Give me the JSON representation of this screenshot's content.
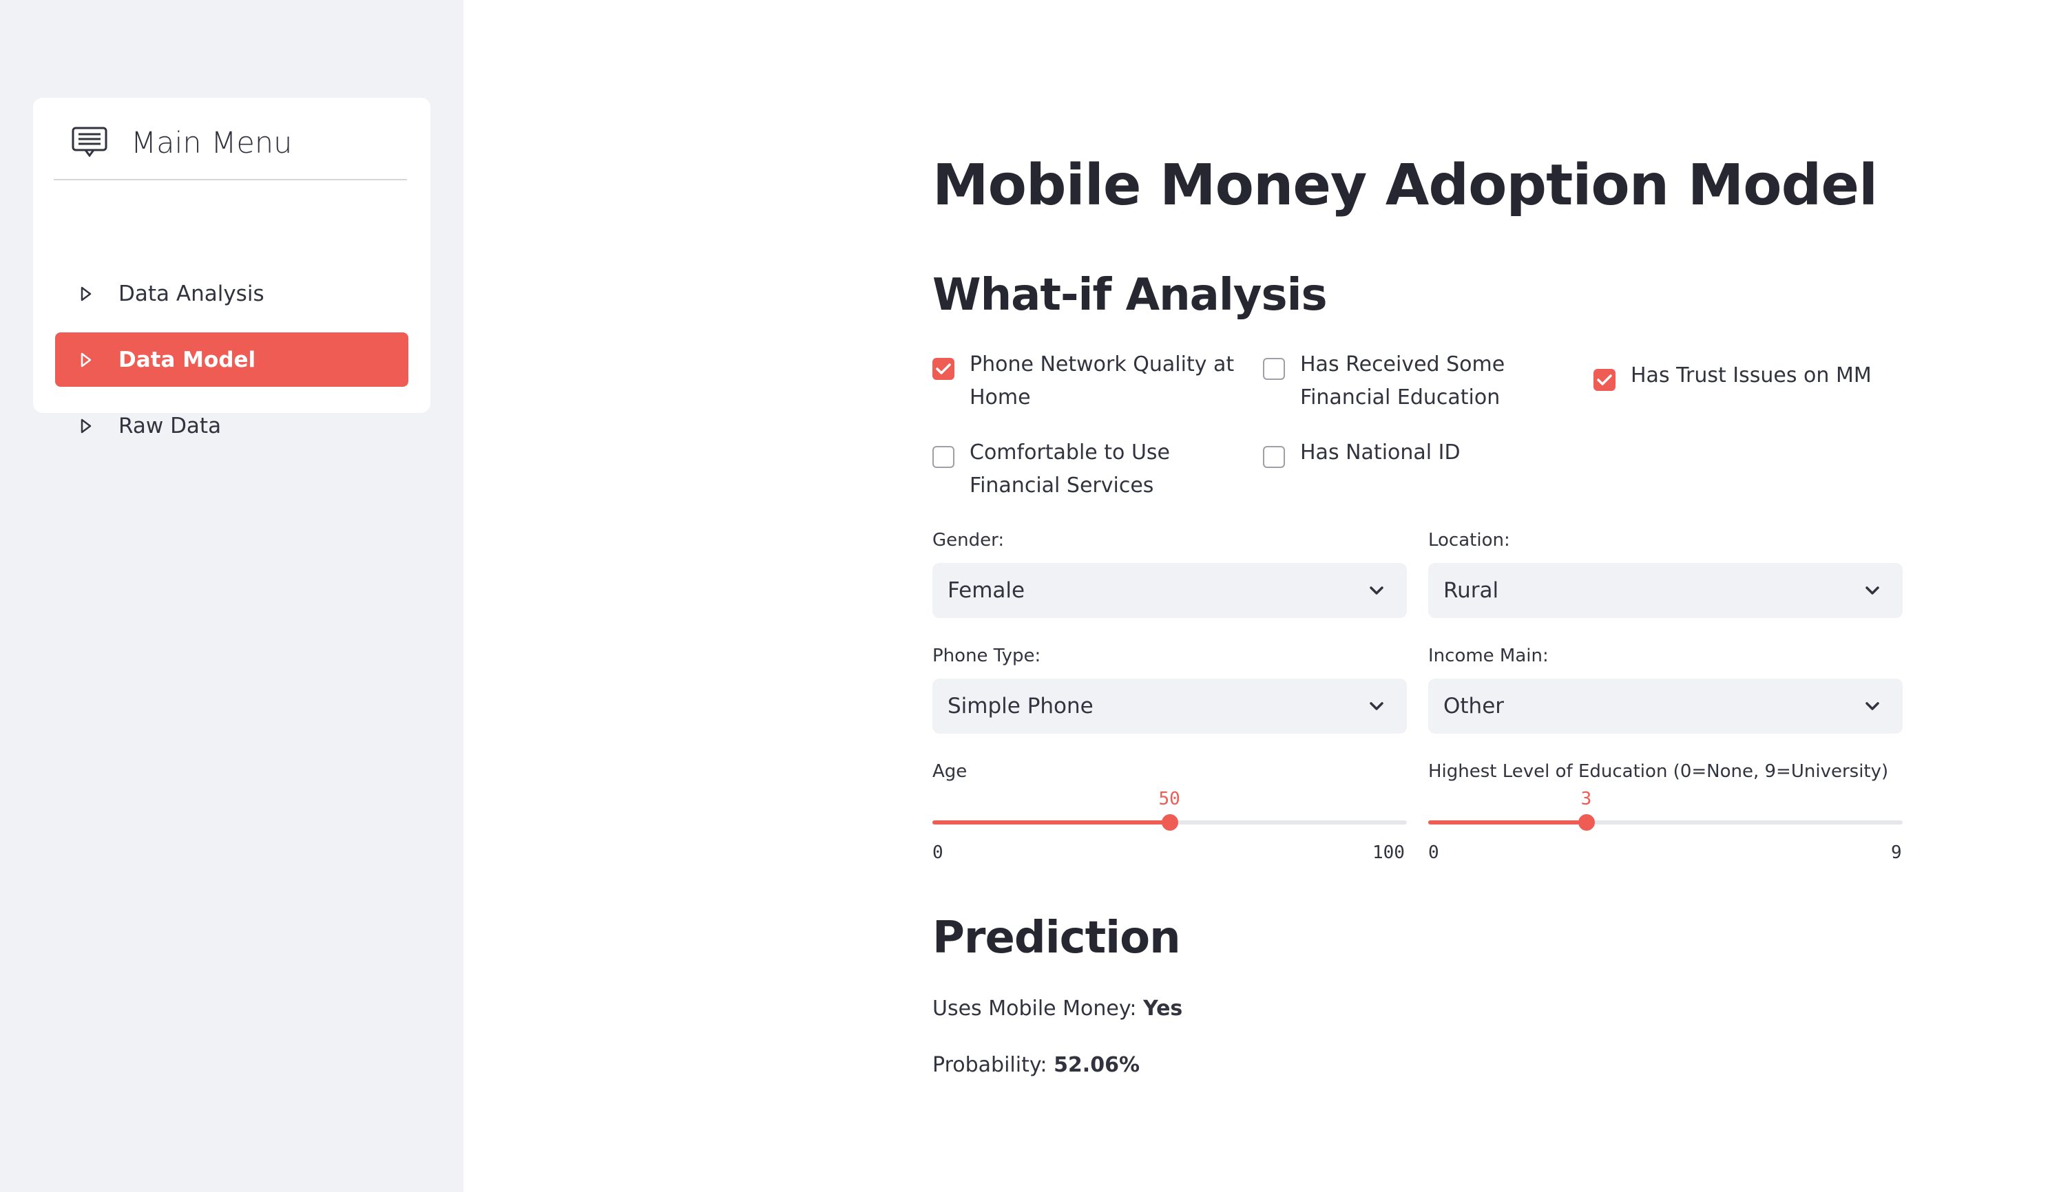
{
  "sidebar": {
    "menu_title": "Main Menu",
    "menu_icon": "menu-card-icon",
    "items": [
      {
        "label": "Data Analysis",
        "icon": "play-outline-icon",
        "active": false
      },
      {
        "label": "Data Model",
        "icon": "play-outline-icon",
        "active": true
      },
      {
        "label": "Raw Data",
        "icon": "play-outline-icon",
        "active": false
      }
    ]
  },
  "main": {
    "title": "Mobile Money Adoption Model",
    "section_whatif": "What-if Analysis",
    "checkboxes": [
      {
        "label": "Phone Network Quality at Home",
        "checked": true
      },
      {
        "label": "Has Received Some Financial Education",
        "checked": false
      },
      {
        "label": "Has Trust Issues on MM",
        "checked": true
      },
      {
        "label": "Comfortable to Use Financial Services",
        "checked": false
      },
      {
        "label": "Has National ID",
        "checked": false
      }
    ],
    "selects": {
      "gender": {
        "label": "Gender:",
        "value": "Female"
      },
      "location": {
        "label": "Location:",
        "value": "Rural"
      },
      "phone_type": {
        "label": "Phone Type:",
        "value": "Simple Phone"
      },
      "income_main": {
        "label": "Income Main:",
        "value": "Other"
      }
    },
    "sliders": {
      "age": {
        "label": "Age",
        "min": "0",
        "max": "100",
        "value": "50",
        "fraction": 0.5
      },
      "education": {
        "label": "Highest Level of Education (0=None, 9=University)",
        "min": "0",
        "max": "9",
        "value": "3",
        "fraction": 0.3333
      }
    },
    "section_prediction": "Prediction",
    "prediction": {
      "uses_label": "Uses Mobile Money:",
      "uses_value": "Yes",
      "prob_label": "Probability:",
      "prob_value": "52.06%"
    }
  },
  "colors": {
    "accent": "#ef5c54",
    "sidebar_bg": "#f0f2f6",
    "text": "#31333f"
  }
}
